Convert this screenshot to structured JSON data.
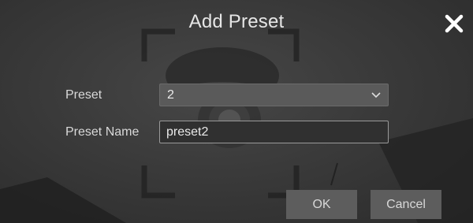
{
  "dialog": {
    "title": "Add Preset",
    "close_icon": "close-icon"
  },
  "form": {
    "preset_label": "Preset",
    "preset_value": "2",
    "preset_name_label": "Preset Name",
    "preset_name_value": "preset2"
  },
  "buttons": {
    "ok_label": "OK",
    "cancel_label": "Cancel"
  },
  "colors": {
    "background": "#3a3a3a",
    "select_bg": "#5a5a5a",
    "input_bg": "#303030",
    "button_bg": "#5d5d5d",
    "text": "#e6e6e6"
  }
}
